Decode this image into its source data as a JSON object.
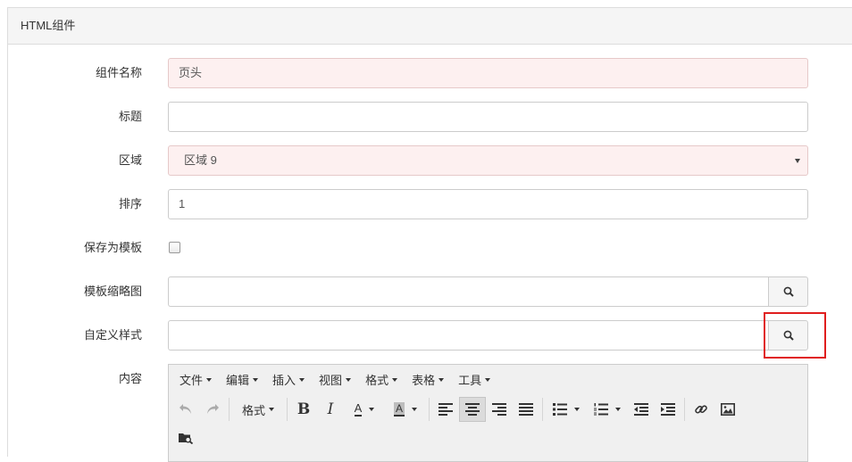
{
  "panel": {
    "title": "HTML组件"
  },
  "form": {
    "name": {
      "label": "组件名称",
      "value": "页头"
    },
    "title": {
      "label": "标题",
      "value": ""
    },
    "zone": {
      "label": "区域",
      "value": "区域 9"
    },
    "sort": {
      "label": "排序",
      "value": "1"
    },
    "save_as_template": {
      "label": "保存为模板",
      "checked": false
    },
    "thumbnail": {
      "label": "模板缩略图",
      "value": ""
    },
    "custom_style": {
      "label": "自定义样式",
      "value": ""
    },
    "content": {
      "label": "内容"
    }
  },
  "editor": {
    "menus": [
      "文件",
      "编辑",
      "插入",
      "视图",
      "格式",
      "表格",
      "工具"
    ],
    "format_label": "格式",
    "bold_label": "B",
    "italic_label": "I",
    "forecolor_label": "A",
    "backcolor_label": "A"
  },
  "colors": {
    "accent_highlight": "#e01e1e",
    "pink_field": "#fdf0f0"
  }
}
